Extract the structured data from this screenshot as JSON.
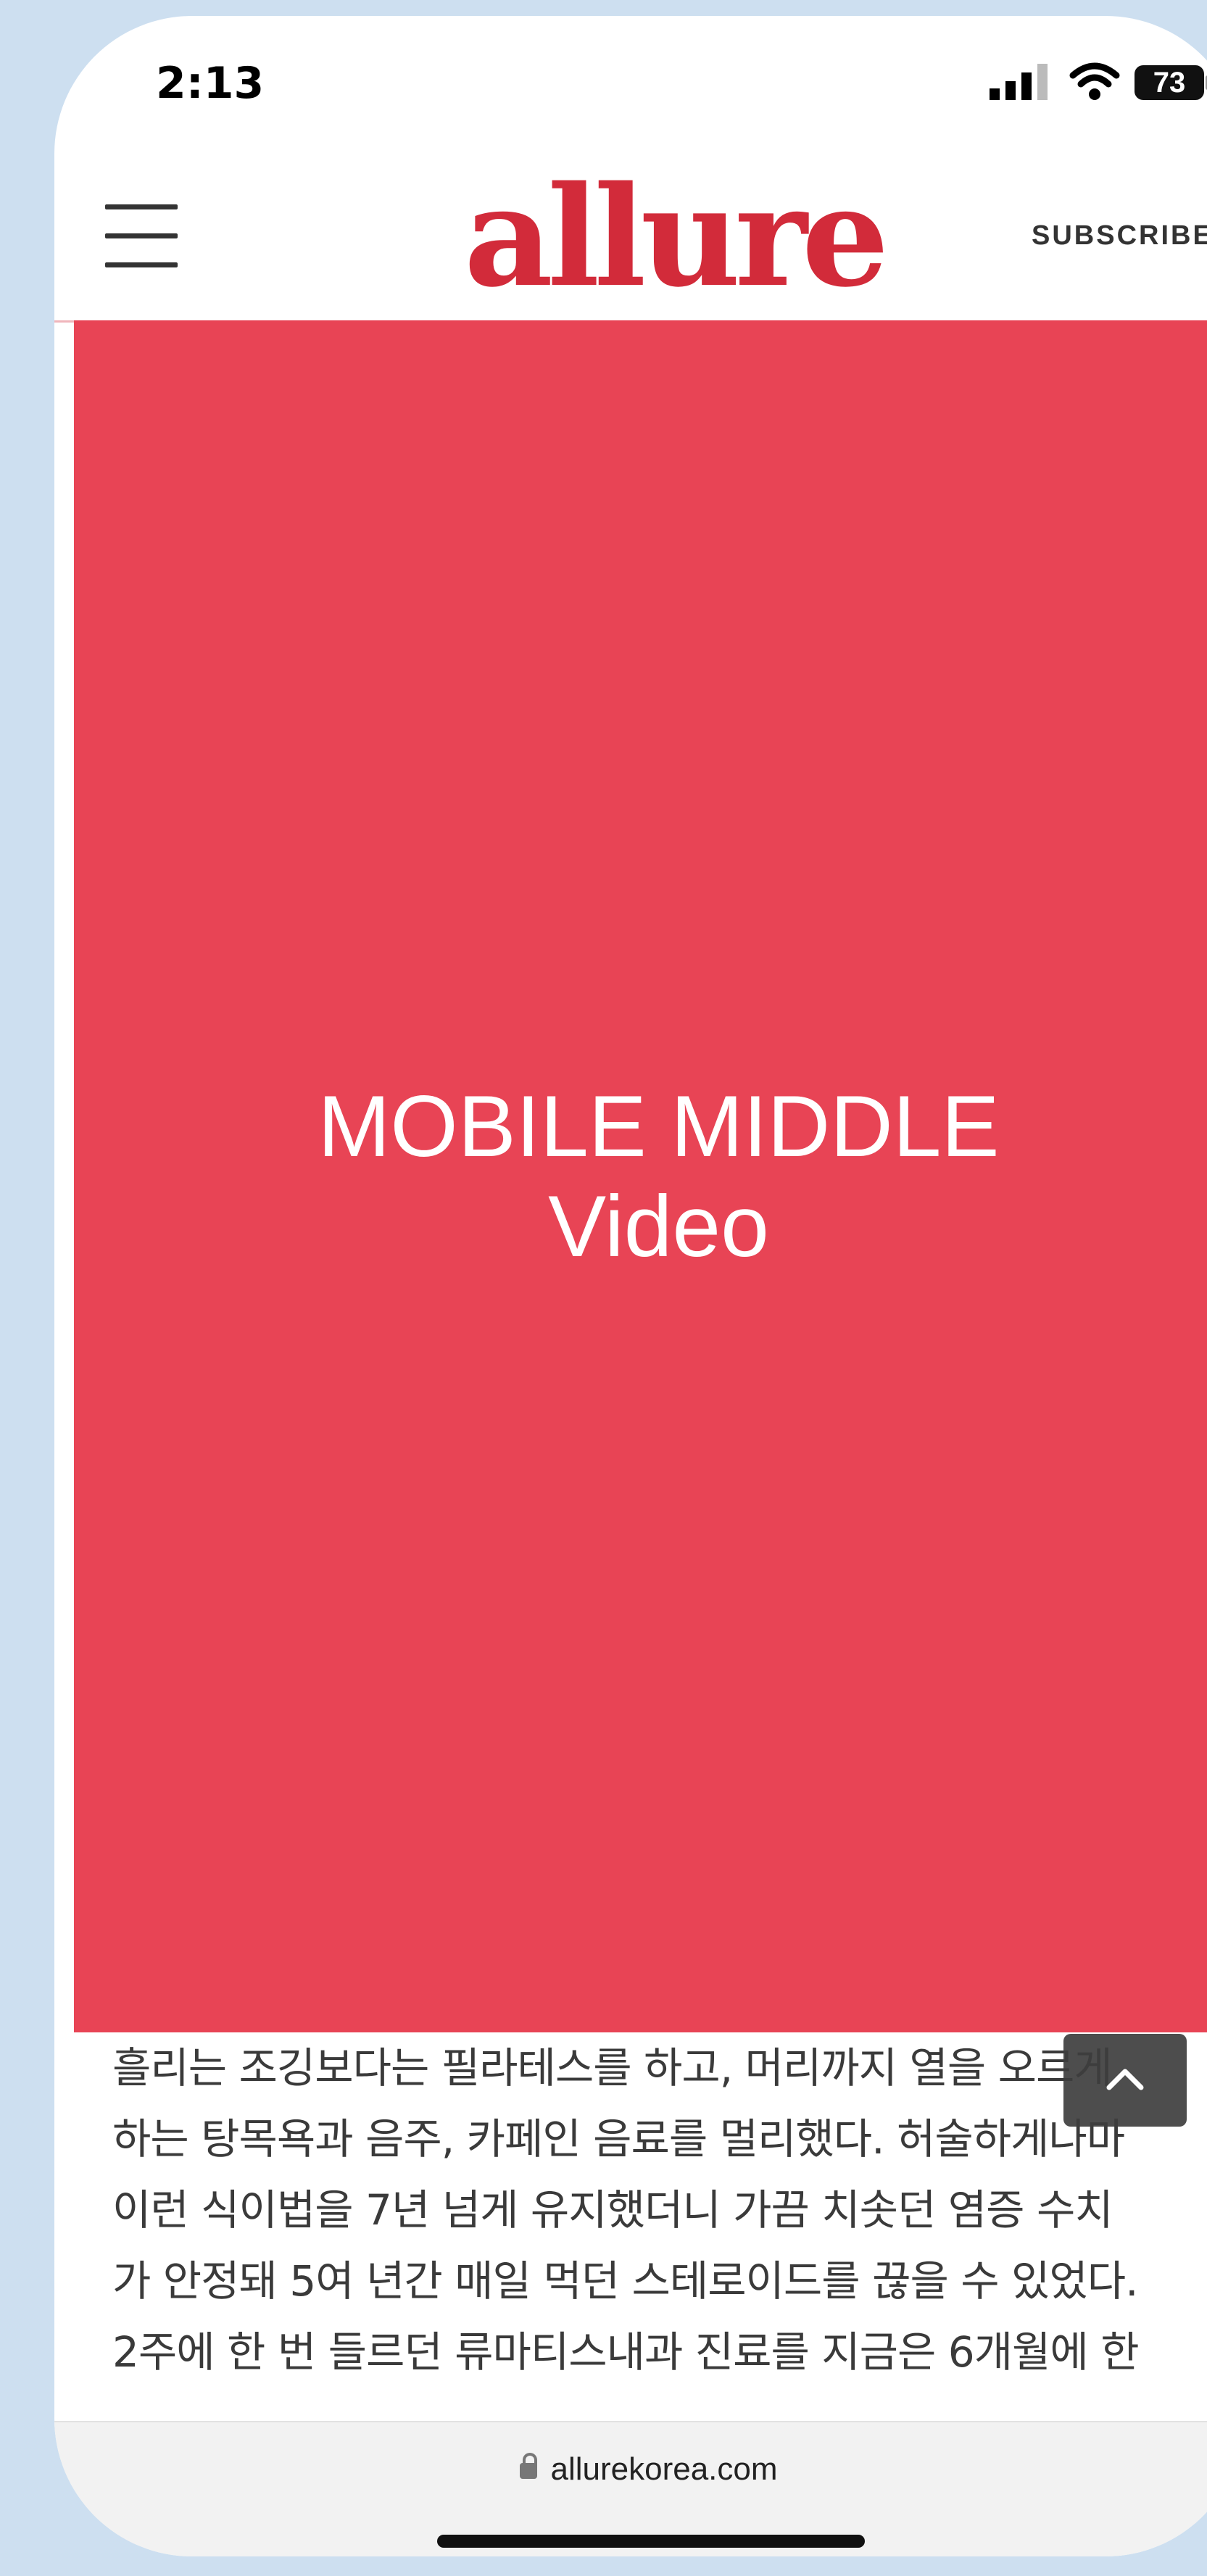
{
  "status_bar": {
    "time": "2:13",
    "battery": "73"
  },
  "header": {
    "logo": "allure",
    "subscribe_label": "SUBSCRIBE",
    "brand_color": "#d22b3a"
  },
  "ad": {
    "line1": "MOBILE MIDDLE",
    "line2": "Video",
    "color": "#e84455"
  },
  "article": {
    "lines": [
      "흘리는 조깅보다는 필라테스를 하고, 머리까지 열을 오르게",
      "하는 탕목욕과 음주, 카페인 음료를 멀리했다. 허술하게나마",
      "이런 식이법을 7년 넘게 유지했더니 가끔 치솟던 염증 수치",
      "가 안정돼 5여 년간 매일 먹던 스테로이드를 끊을 수 있었다.",
      "2주에 한 번 들르던 류마티스내과 진료를 지금은 6개월에 한"
    ]
  },
  "browser": {
    "url": "allurekorea.com"
  }
}
